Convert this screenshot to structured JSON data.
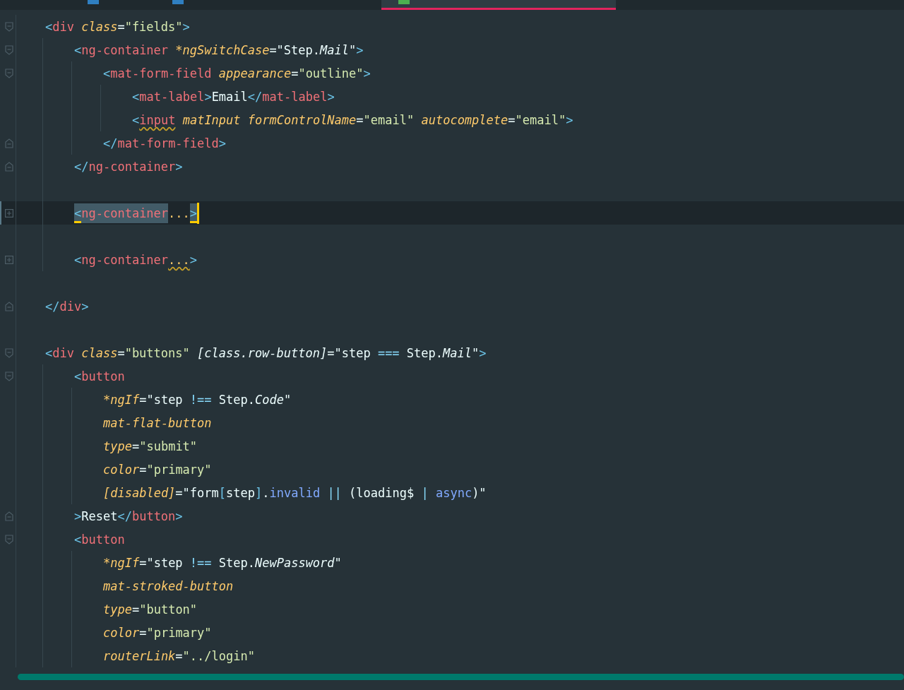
{
  "tabs": [
    {
      "selected": false
    },
    {
      "selected": false
    },
    {
      "selected": true
    }
  ],
  "lines": [
    {
      "kind": "opener",
      "current": false,
      "tokens": [
        {
          "kind": "p",
          "t": "<"
        },
        {
          "kind": "tag",
          "t": "div"
        },
        {
          "kind": "attr",
          "t": " class"
        },
        {
          "kind": "eq",
          "t": "="
        },
        {
          "kind": "str",
          "t": "\"fields\""
        },
        {
          "kind": "p",
          "t": ">"
        }
      ],
      "children": [
        {
          "kind": "opener",
          "current": false,
          "tokens": [
            {
              "kind": "p",
              "t": "<"
            },
            {
              "kind": "tag",
              "t": "ng-container"
            },
            {
              "kind": "attr",
              "t": " *ngSwitchCase"
            },
            {
              "kind": "eq",
              "t": "=\"Step."
            },
            {
              "kind": "mem",
              "t": "Mail"
            },
            {
              "kind": "eq",
              "t": "\""
            },
            {
              "kind": "p",
              "t": ">"
            }
          ],
          "children": [
            {
              "kind": "opener",
              "current": false,
              "tokens": [
                {
                  "kind": "p",
                  "t": "<"
                },
                {
                  "kind": "tag",
                  "t": "mat-form-field"
                },
                {
                  "kind": "attr",
                  "t": " appearance"
                },
                {
                  "kind": "eq",
                  "t": "="
                },
                {
                  "kind": "str",
                  "t": "\"outline\""
                },
                {
                  "kind": "p",
                  "t": ">"
                }
              ],
              "children": [
                {
                  "current": false,
                  "tokens": [
                    {
                      "kind": "p",
                      "t": "<"
                    },
                    {
                      "kind": "tag",
                      "t": "mat-label"
                    },
                    {
                      "kind": "p",
                      "t": ">"
                    },
                    {
                      "kind": "txt",
                      "t": "Email"
                    },
                    {
                      "kind": "p",
                      "t": "</"
                    },
                    {
                      "kind": "tag",
                      "t": "mat-label"
                    },
                    {
                      "kind": "p",
                      "t": ">"
                    }
                  ]
                },
                {
                  "current": false,
                  "tokens": [
                    {
                      "kind": "p",
                      "t": "<"
                    },
                    {
                      "kind": "tag",
                      "t": "input",
                      "warn": true
                    },
                    {
                      "kind": "attr",
                      "t": " matInput formControlName"
                    },
                    {
                      "kind": "eq",
                      "t": "="
                    },
                    {
                      "kind": "str",
                      "t": "\"email\""
                    },
                    {
                      "kind": "attr",
                      "t": " autocomplete"
                    },
                    {
                      "kind": "eq",
                      "t": "="
                    },
                    {
                      "kind": "str",
                      "t": "\"email\""
                    },
                    {
                      "kind": "p",
                      "t": ">"
                    }
                  ]
                }
              ]
            },
            {
              "kind": "closer",
              "current": false,
              "tokens": [
                {
                  "kind": "p",
                  "t": "</"
                },
                {
                  "kind": "tag",
                  "t": "mat-form-field"
                },
                {
                  "kind": "p",
                  "t": ">"
                }
              ]
            }
          ]
        },
        {
          "kind": "closer",
          "current": false,
          "tokens": [
            {
              "kind": "p",
              "t": "</"
            },
            {
              "kind": "tag",
              "t": "ng-container"
            },
            {
              "kind": "p",
              "t": ">"
            }
          ]
        },
        {
          "current": false
        },
        {
          "kind": "folded",
          "current": true,
          "tokens": [
            {
              "kind": "p",
              "t": "<",
              "selected": true,
              "matched": true
            },
            {
              "kind": "tag",
              "t": "ng-container",
              "selected": true
            },
            {
              "kind": "dots",
              "t": "..."
            },
            {
              "kind": "p",
              "t": ">",
              "selected": true,
              "matched": true
            }
          ]
        },
        {
          "current": false
        },
        {
          "kind": "folded",
          "current": false,
          "tokens": [
            {
              "kind": "p",
              "t": "<"
            },
            {
              "kind": "tag",
              "t": "ng-container"
            },
            {
              "kind": "dots",
              "t": "...",
              "warn": true
            },
            {
              "kind": "p",
              "t": ">"
            }
          ]
        },
        {
          "current": false
        }
      ]
    },
    {
      "kind": "closer",
      "current": false,
      "tokens": [
        {
          "kind": "p",
          "t": "</"
        },
        {
          "kind": "tag",
          "t": "div"
        },
        {
          "kind": "p",
          "t": ">"
        }
      ]
    },
    {
      "current": false
    },
    {
      "kind": "opener",
      "current": false,
      "tokens": [
        {
          "kind": "p",
          "t": "<"
        },
        {
          "kind": "tag",
          "t": "div"
        },
        {
          "kind": "attr",
          "t": " class"
        },
        {
          "kind": "eq",
          "t": "="
        },
        {
          "kind": "str",
          "t": "\"buttons\""
        },
        {
          "kind": "bind",
          "t": " [class.row-button]"
        },
        {
          "kind": "eq",
          "t": "=\"step "
        },
        {
          "kind": "op",
          "t": "==="
        },
        {
          "kind": "eq",
          "t": " Step."
        },
        {
          "kind": "mem",
          "t": "Mail"
        },
        {
          "kind": "eq",
          "t": "\""
        },
        {
          "kind": "p",
          "t": ">"
        }
      ],
      "children": [
        {
          "kind": "opener",
          "current": false,
          "tokens": [
            {
              "kind": "p",
              "t": "<"
            },
            {
              "kind": "tag",
              "t": "button"
            }
          ],
          "children": [
            {
              "current": false,
              "tokens": [
                {
                  "kind": "attr",
                  "t": "*ngIf"
                },
                {
                  "kind": "eq",
                  "t": "=\"step "
                },
                {
                  "kind": "op",
                  "t": "!=="
                },
                {
                  "kind": "eq",
                  "t": " Step."
                },
                {
                  "kind": "mem",
                  "t": "Code"
                },
                {
                  "kind": "eq",
                  "t": "\""
                }
              ]
            },
            {
              "current": false,
              "tokens": [
                {
                  "kind": "attr",
                  "t": "mat-flat-button"
                }
              ]
            },
            {
              "current": false,
              "tokens": [
                {
                  "kind": "attr",
                  "t": "type"
                },
                {
                  "kind": "eq",
                  "t": "="
                },
                {
                  "kind": "str",
                  "t": "\"submit\""
                }
              ]
            },
            {
              "current": false,
              "tokens": [
                {
                  "kind": "attr",
                  "t": "color"
                },
                {
                  "kind": "eq",
                  "t": "="
                },
                {
                  "kind": "str",
                  "t": "\"primary\""
                }
              ]
            },
            {
              "current": false,
              "tokens": [
                {
                  "kind": "attr",
                  "t": "[disabled]"
                },
                {
                  "kind": "eq",
                  "t": "=\"form"
                },
                {
                  "kind": "p",
                  "t": "["
                },
                {
                  "kind": "eq",
                  "t": "step"
                },
                {
                  "kind": "p",
                  "t": "]"
                },
                {
                  "kind": "eq",
                  "t": "."
                },
                {
                  "kind": "prop",
                  "t": "invalid"
                },
                {
                  "kind": "op",
                  "t": " || "
                },
                {
                  "kind": "eq",
                  "t": "(loading$ "
                },
                {
                  "kind": "op",
                  "t": "|"
                },
                {
                  "kind": "prop",
                  "t": " async"
                },
                {
                  "kind": "eq",
                  "t": ")\""
                }
              ]
            }
          ]
        },
        {
          "kind": "closer",
          "current": false,
          "tokens": [
            {
              "kind": "p",
              "t": ">"
            },
            {
              "kind": "txt",
              "t": "Reset"
            },
            {
              "kind": "p",
              "t": "</"
            },
            {
              "kind": "tag",
              "t": "button"
            },
            {
              "kind": "p",
              "t": ">"
            }
          ]
        },
        {
          "kind": "opener",
          "current": false,
          "tokens": [
            {
              "kind": "p",
              "t": "<"
            },
            {
              "kind": "tag",
              "t": "button"
            }
          ],
          "children": [
            {
              "current": false,
              "tokens": [
                {
                  "kind": "attr",
                  "t": "*ngIf"
                },
                {
                  "kind": "eq",
                  "t": "=\"step "
                },
                {
                  "kind": "op",
                  "t": "!=="
                },
                {
                  "kind": "eq",
                  "t": " Step."
                },
                {
                  "kind": "mem",
                  "t": "NewPassword"
                },
                {
                  "kind": "eq",
                  "t": "\""
                }
              ]
            },
            {
              "current": false,
              "tokens": [
                {
                  "kind": "attr",
                  "t": "mat-stroked-button"
                }
              ]
            },
            {
              "current": false,
              "tokens": [
                {
                  "kind": "attr",
                  "t": "type"
                },
                {
                  "kind": "eq",
                  "t": "="
                },
                {
                  "kind": "str",
                  "t": "\"button\""
                }
              ]
            },
            {
              "current": false,
              "tokens": [
                {
                  "kind": "attr",
                  "t": "color"
                },
                {
                  "kind": "eq",
                  "t": "="
                },
                {
                  "kind": "str",
                  "t": "\"primary\""
                }
              ]
            },
            {
              "current": false,
              "tokens": [
                {
                  "kind": "attr",
                  "t": "routerLink"
                },
                {
                  "kind": "eq",
                  "t": "="
                },
                {
                  "kind": "str",
                  "t": "\"../login\""
                }
              ]
            }
          ]
        }
      ]
    }
  ]
}
